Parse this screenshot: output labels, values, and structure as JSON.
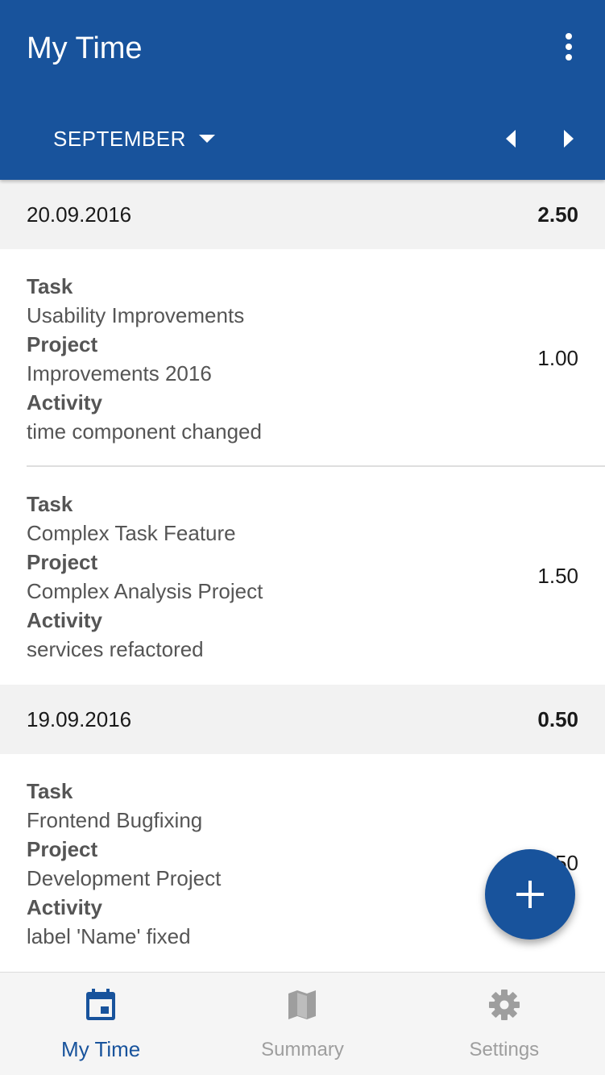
{
  "appbar": {
    "title": "My Time",
    "menu_icon": "more-vert-icon",
    "month": "SEPTEMBER",
    "prev_icon": "arrow-left-icon",
    "next_icon": "arrow-right-icon"
  },
  "days": [
    {
      "date": "20.09.2016",
      "total": "2.50",
      "entries": [
        {
          "task_label": "Task",
          "task": "Usability Improvements",
          "project_label": "Project",
          "project": "Improvements 2016",
          "activity_label": "Activity",
          "activity": "time component changed",
          "hours": "1.00"
        },
        {
          "task_label": "Task",
          "task": "Complex Task Feature",
          "project_label": "Project",
          "project": "Complex Analysis Project",
          "activity_label": "Activity",
          "activity": "services refactored",
          "hours": "1.50"
        }
      ]
    },
    {
      "date": "19.09.2016",
      "total": "0.50",
      "entries": [
        {
          "task_label": "Task",
          "task": "Frontend Bugfixing",
          "project_label": "Project",
          "project": "Development Project",
          "activity_label": "Activity",
          "activity": "label 'Name' fixed",
          "hours": "0.50"
        }
      ]
    }
  ],
  "fab": {
    "icon": "plus-icon"
  },
  "bottom_nav": [
    {
      "label": "My Time",
      "icon": "calendar-icon",
      "active": true
    },
    {
      "label": "Summary",
      "icon": "map-icon",
      "active": false
    },
    {
      "label": "Settings",
      "icon": "gear-icon",
      "active": false
    }
  ],
  "colors": {
    "primary": "#18539c",
    "header_bg": "#f2f2f2",
    "text_secondary": "#555555",
    "nav_inactive": "#9e9e9e"
  }
}
